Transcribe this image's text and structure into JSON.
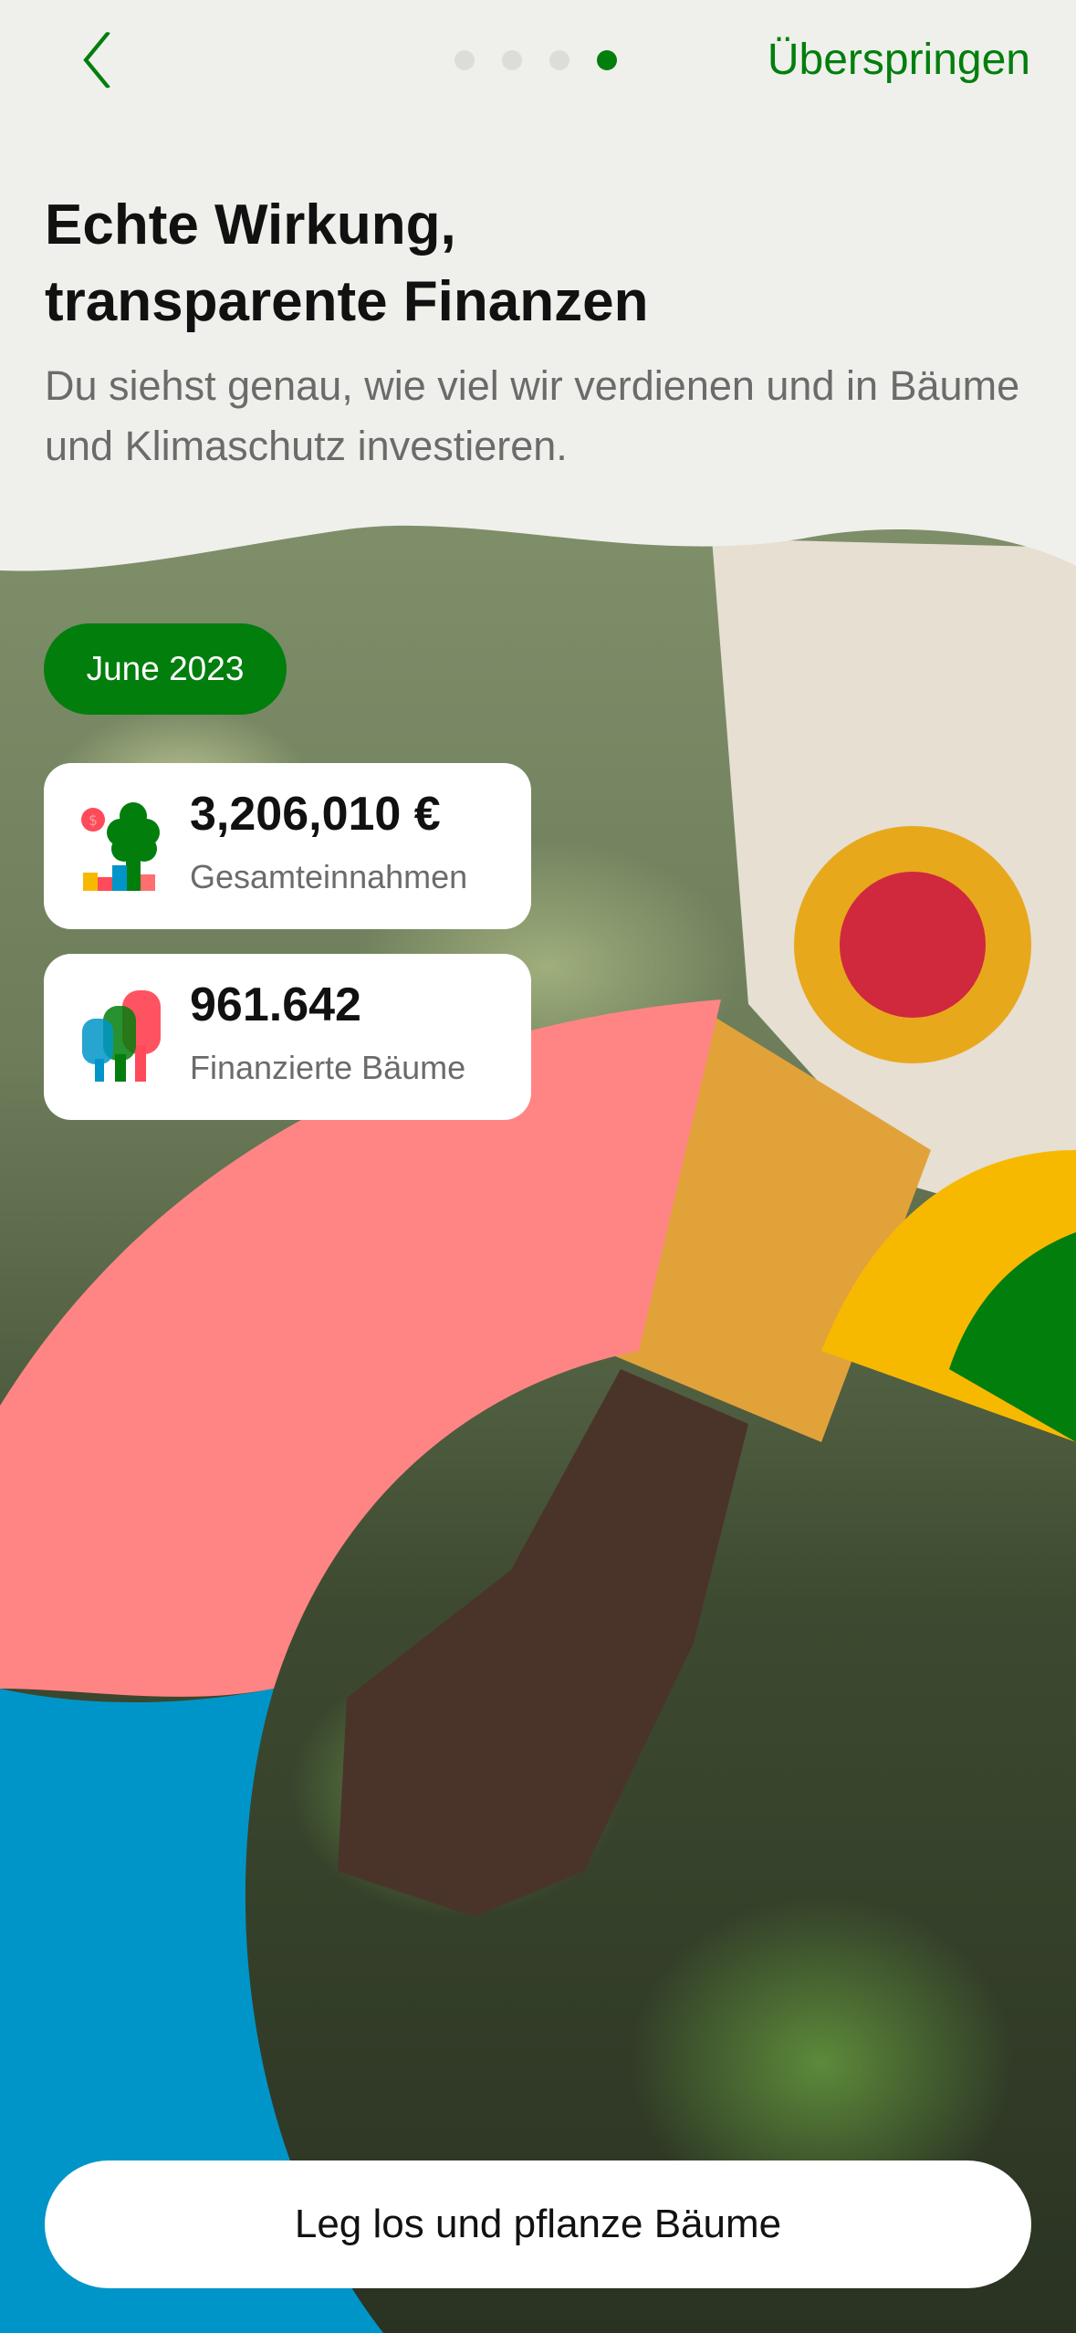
{
  "header": {
    "back_icon": "chevron-left-icon",
    "pages_total": 4,
    "current_page": 4,
    "skip_label": "Überspringen"
  },
  "title": "Echte Wirkung, transparente Finanzen",
  "subtitle": "Du siehst genau, wie viel wir verdienen und in Bäume und Klimaschutz investieren.",
  "period": "June 2023",
  "stats": [
    {
      "value": "3,206,010 €",
      "label": "Gesamteinnahmen",
      "icon": "revenue-tree-chart-icon"
    },
    {
      "value": "961.642",
      "label": "Finanzierte Bäume",
      "icon": "trees-icon"
    }
  ],
  "cta_label": "Leg los und pflanze Bäume",
  "colors": {
    "accent": "#027e0d",
    "pink": "#ff8585",
    "blue": "#0095c8",
    "yellow": "#f7b900",
    "background": "#eff0eb"
  }
}
